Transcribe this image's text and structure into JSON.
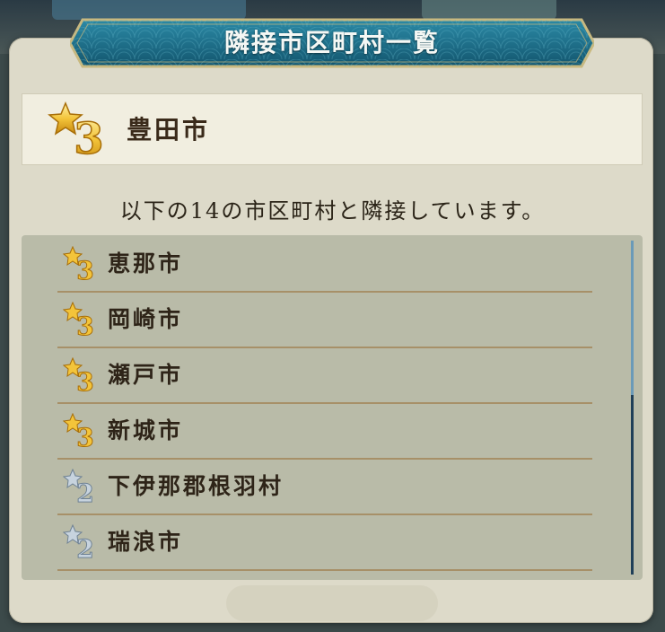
{
  "dialog": {
    "title": "隣接市区町村一覧",
    "selected": {
      "rank": "3",
      "name": "豊田市"
    },
    "subtitle": "以下の14の市区町村と隣接しています。",
    "list": [
      {
        "rank": "3",
        "name": "恵那市"
      },
      {
        "rank": "3",
        "name": "岡崎市"
      },
      {
        "rank": "3",
        "name": "瀬戸市"
      },
      {
        "rank": "3",
        "name": "新城市"
      },
      {
        "rank": "2",
        "name": "下伊那郡根羽村"
      },
      {
        "rank": "2",
        "name": "瑞浪市"
      }
    ]
  },
  "colors": {
    "gold_star": "#f3c43a",
    "silver_star": "#b9c6d2",
    "banner": "#1f6c84"
  },
  "icons": {
    "gold_badge": "gold-star-3-icon",
    "silver_badge": "silver-star-2-icon"
  }
}
